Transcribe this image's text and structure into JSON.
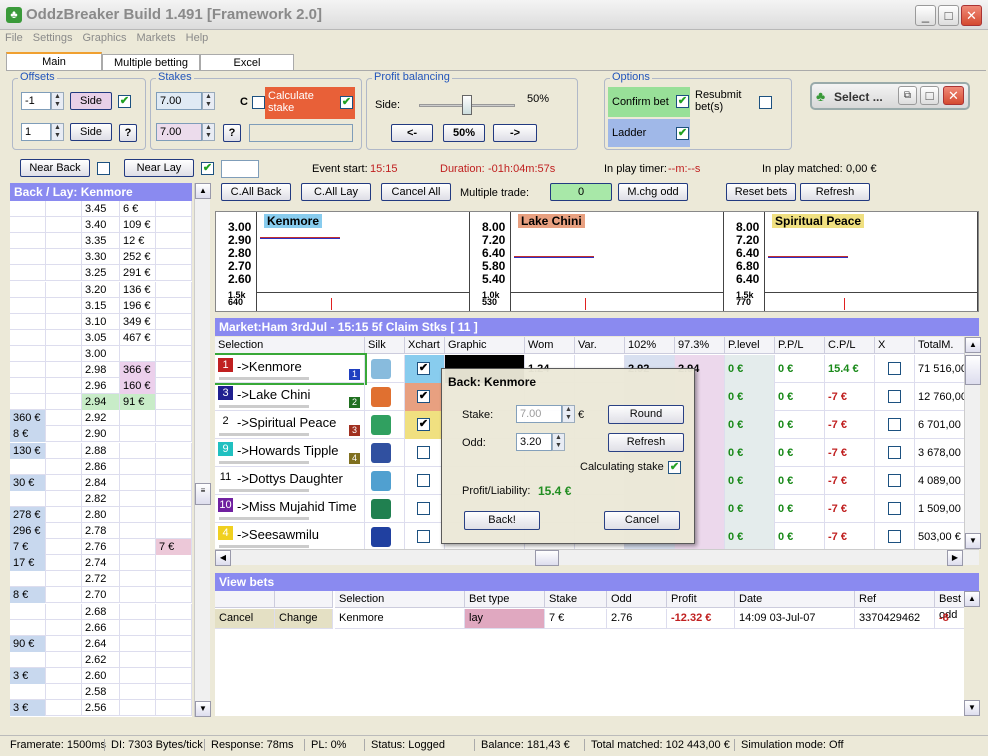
{
  "window": {
    "title": "OddzBreaker Build 1.491 [Framework 2.0]",
    "min": "_",
    "max": "□",
    "close": "✕"
  },
  "menu": [
    "File",
    "Settings",
    "Graphics",
    "Markets",
    "Help"
  ],
  "tabs": [
    "Main",
    "Multiple betting",
    "Excel"
  ],
  "offsets": {
    "label": "Offsets",
    "v1": "-1",
    "v2": "1",
    "side": "Side",
    "help": "?"
  },
  "stakes": {
    "label": "Stakes",
    "v1": "7.00",
    "v2": "7.00",
    "c": "C",
    "calc": "Calculate stake",
    "help": "?"
  },
  "profit": {
    "label": "Profit balancing",
    "side": "Side:",
    "pct": "50%",
    "left": "<-",
    "mid": "50%",
    "right": "->",
    "slider_level": 0.5
  },
  "options": {
    "label": "Options",
    "confirm": "Confirm bet",
    "resubmit": "Resubmit bet(s)",
    "ladder": "Ladder"
  },
  "select_btn": "Select ...",
  "nearback": "Near Back",
  "nearlay": "Near Lay",
  "event": {
    "start_label": "Event start:",
    "start": "15:15",
    "dur_label": "Duration:",
    "dur": "-01h:04m:57s",
    "inplay_label": "In play timer:",
    "inplay": "--m:--s",
    "matched_label": "In play matched:",
    "matched": "0,00 €"
  },
  "actions": {
    "callback": "C.All Back",
    "calllay": "C.All Lay",
    "cancelall": "Cancel All",
    "multi": "Multiple trade:",
    "zero": "0",
    "mchg": "M.chg odd",
    "reset": "Reset bets",
    "refresh": "Refresh"
  },
  "ladder": {
    "title": "Back / Lay: Kenmore",
    "rows": [
      [
        "",
        "",
        "3.45",
        "6 €",
        ""
      ],
      [
        "",
        "",
        "3.40",
        "109 €",
        ""
      ],
      [
        "",
        "",
        "3.35",
        "12 €",
        ""
      ],
      [
        "",
        "",
        "3.30",
        "252 €",
        ""
      ],
      [
        "",
        "",
        "3.25",
        "291 €",
        ""
      ],
      [
        "",
        "",
        "3.20",
        "136 €",
        ""
      ],
      [
        "",
        "",
        "3.15",
        "196 €",
        ""
      ],
      [
        "",
        "",
        "3.10",
        "349 €",
        ""
      ],
      [
        "",
        "",
        "3.05",
        "467 €",
        ""
      ],
      [
        "",
        "",
        "3.00",
        "",
        ""
      ],
      [
        "",
        "",
        "2.98",
        "366 €",
        ""
      ],
      [
        "",
        "",
        "2.96",
        "160 €",
        ""
      ],
      [
        "",
        "",
        "2.94",
        "91 €",
        ""
      ],
      [
        "360 €",
        "",
        "2.92",
        "",
        ""
      ],
      [
        "8 €",
        "",
        "2.90",
        "",
        ""
      ],
      [
        "130 €",
        "",
        "2.88",
        "",
        ""
      ],
      [
        "",
        "",
        "2.86",
        "",
        ""
      ],
      [
        "30 €",
        "",
        "2.84",
        "",
        ""
      ],
      [
        "",
        "",
        "2.82",
        "",
        ""
      ],
      [
        "278 €",
        "",
        "2.80",
        "",
        ""
      ],
      [
        "296 €",
        "",
        "2.78",
        "",
        ""
      ],
      [
        "7 €",
        "",
        "2.76",
        "",
        "7 €"
      ],
      [
        "17 €",
        "",
        "2.74",
        "",
        ""
      ],
      [
        "",
        "",
        "2.72",
        "",
        ""
      ],
      [
        "8 €",
        "",
        "2.70",
        "",
        ""
      ],
      [
        "",
        "",
        "2.68",
        "",
        ""
      ],
      [
        "",
        "",
        "2.66",
        "",
        ""
      ],
      [
        "90 €",
        "",
        "2.64",
        "",
        ""
      ],
      [
        "",
        "",
        "2.62",
        "",
        ""
      ],
      [
        "3 €",
        "",
        "2.60",
        "",
        ""
      ],
      [
        "",
        "",
        "2.58",
        "",
        ""
      ],
      [
        "3 €",
        "",
        "2.56",
        "",
        ""
      ]
    ]
  },
  "charts": [
    {
      "name": "Kenmore",
      "color": "#88ccee",
      "ticks": [
        "3.00",
        "2.90",
        "2.80",
        "2.70",
        "2.60"
      ],
      "vol": [
        "1.5k",
        "640"
      ]
    },
    {
      "name": "Lake Chini",
      "color": "#e8a080",
      "ticks": [
        "8.00",
        "7.20",
        "6.40",
        "5.80",
        "5.40"
      ],
      "vol": [
        "1.0k",
        "530"
      ]
    },
    {
      "name": "Spiritual Peace",
      "color": "#f0e080",
      "ticks": [
        "8.00",
        "7.20",
        "6.40",
        "6.80",
        "6.40"
      ],
      "vol": [
        "1.5k",
        "770"
      ]
    }
  ],
  "market": {
    "title": "Market:Ham 3rdJul - 15:15 5f Claim Stks [ 11 ]",
    "headers": [
      "Selection",
      "Silk",
      "Xchart",
      "Graphic",
      "Wom",
      "Var.",
      "102%",
      "97.3%",
      "P.level",
      "P.P/L",
      "C.P/L",
      "X",
      "TotalM."
    ],
    "rows": [
      {
        "n": "1",
        "nc": "#c02020",
        "name": "->Kenmore",
        "badge": "1",
        "bc": "#2040c0",
        "silk": "#88bbdd",
        "x": true,
        "xc": "#88ccee",
        "wom": "1.24",
        "p102": "2.92",
        "p97": "2.94",
        "pl": "0 €",
        "ppl": "0 €",
        "cpl": "15.4 €",
        "tm": "71 516,00"
      },
      {
        "n": "3",
        "nc": "#202090",
        "name": "->Lake Chini",
        "badge": "2",
        "bc": "#207020",
        "silk": "#e07030",
        "x": true,
        "xc": "#e8a080",
        "wom": "",
        "p102": "",
        "p97": "",
        "pl": "0 €",
        "ppl": "0 €",
        "cpl": "-7 €",
        "tm": "12 760,00"
      },
      {
        "n": "2",
        "nc": "#ffffff",
        "name": "->Spiritual Peace",
        "badge": "3",
        "bc": "#a03020",
        "silk": "#30a060",
        "x": true,
        "xc": "#f0e080",
        "wom": "",
        "p102": "",
        "p97": "",
        "pl": "0 €",
        "ppl": "0 €",
        "cpl": "-7 €",
        "tm": "6 701,00"
      },
      {
        "n": "9",
        "nc": "#20c0c0",
        "name": "->Howards Tipple",
        "badge": "4",
        "bc": "#807020",
        "silk": "#3050a0",
        "x": false,
        "xc": "",
        "wom": "",
        "p102": "",
        "p97": "",
        "pl": "0 €",
        "ppl": "0 €",
        "cpl": "-7 €",
        "tm": "3 678,00"
      },
      {
        "n": "11",
        "nc": "#ffffff",
        "name": "->Dottys Daughter",
        "badge": "",
        "bc": "",
        "silk": "#50a0d0",
        "x": false,
        "xc": "",
        "wom": "",
        "p102": "",
        "p97": "",
        "pl": "0 €",
        "ppl": "0 €",
        "cpl": "-7 €",
        "tm": "4 089,00"
      },
      {
        "n": "10",
        "nc": "#7020a0",
        "name": "->Miss Mujahid Time",
        "badge": "",
        "bc": "",
        "silk": "#208050",
        "x": false,
        "xc": "",
        "wom": "",
        "p102": "",
        "p97": "",
        "pl": "0 €",
        "ppl": "0 €",
        "cpl": "-7 €",
        "tm": "1 509,00"
      },
      {
        "n": "4",
        "nc": "#f0d020",
        "name": "->Seesawmilu",
        "badge": "",
        "bc": "",
        "silk": "#2040a0",
        "x": false,
        "xc": "",
        "wom": "",
        "p102": "",
        "p97": "",
        "pl": "0 €",
        "ppl": "0 €",
        "cpl": "-7 €",
        "tm": "503,00 €"
      }
    ]
  },
  "dialog": {
    "title": "Back: Kenmore",
    "stake_lbl": "Stake:",
    "stake": "7.00",
    "eur": "€",
    "odd_lbl": "Odd:",
    "odd": "3.20",
    "round": "Round",
    "refresh": "Refresh",
    "calc": "Calculating stake",
    "pl_lbl": "Profit/Liability:",
    "pl": "15.4 €",
    "back": "Back!",
    "cancel": "Cancel"
  },
  "viewbets": {
    "title": "View bets",
    "headers": [
      "",
      "",
      "Selection",
      "Bet type",
      "Stake",
      "Odd",
      "Profit",
      "Date",
      "Ref",
      "Best odd"
    ],
    "row": [
      "Cancel",
      "Change",
      "Kenmore",
      "lay",
      "7 €",
      "2.76",
      "-12.32 €",
      "14:09 03-Jul-07",
      "3370429462",
      "-8"
    ]
  },
  "status": [
    "Framerate: 1500ms",
    "DI: 7303 Bytes/tick",
    "Response: 78ms",
    "PL: 0%",
    "Status: Logged",
    "Balance: 181,43 €",
    "Total matched: 102 443,00 €",
    "Simulation mode: Off"
  ]
}
